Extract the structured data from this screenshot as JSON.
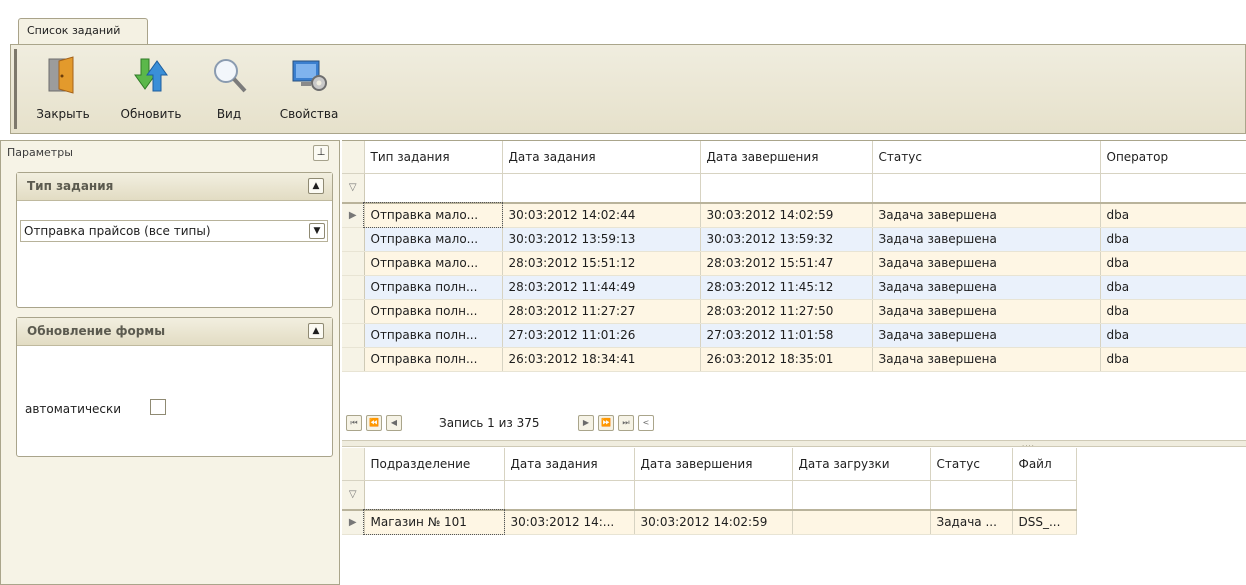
{
  "tab": {
    "title": "Список заданий"
  },
  "toolbar": {
    "buttons": [
      {
        "label": "Закрыть",
        "icon": "door-exit-icon"
      },
      {
        "label": "Обновить",
        "icon": "refresh-arrows-icon"
      },
      {
        "label": "Вид",
        "icon": "magnifier-icon"
      },
      {
        "label": "Свойства",
        "icon": "monitor-settings-icon"
      }
    ]
  },
  "left_panel": {
    "header": "Параметры",
    "task_type_group": {
      "title": "Тип задания",
      "selected": "Отправка прайсов (все типы)"
    },
    "refresh_group": {
      "title": "Обновление формы",
      "auto_label": "автоматически",
      "auto_checked": false
    }
  },
  "main_grid": {
    "columns": [
      "Тип задания",
      "Дата задания",
      "Дата завершения",
      "Статус",
      "Оператор"
    ],
    "rows": [
      [
        "Отправка мало...",
        "30:03:2012 14:02:44",
        "30:03:2012 14:02:59",
        "Задача завершена",
        "dba"
      ],
      [
        "Отправка мало...",
        "30:03:2012 13:59:13",
        "30:03:2012 13:59:32",
        "Задача завершена",
        "dba"
      ],
      [
        "Отправка мало...",
        "28:03:2012 15:51:12",
        "28:03:2012 15:51:47",
        "Задача завершена",
        "dba"
      ],
      [
        "Отправка полн...",
        "28:03:2012 11:44:49",
        "28:03:2012 11:45:12",
        "Задача завершена",
        "dba"
      ],
      [
        "Отправка полн...",
        "28:03:2012 11:27:27",
        "28:03:2012 11:27:50",
        "Задача завершена",
        "dba"
      ],
      [
        "Отправка полн...",
        "27:03:2012 11:01:26",
        "27:03:2012 11:01:58",
        "Задача завершена",
        "dba"
      ],
      [
        "Отправка полн...",
        "26:03:2012 18:34:41",
        "26:03:2012 18:35:01",
        "Задача завершена",
        "dba"
      ]
    ],
    "navigator": {
      "text": "Запись 1 из 375"
    }
  },
  "detail_grid": {
    "columns": [
      "Подразделение",
      "Дата задания",
      "Дата завершения",
      "Дата загрузки",
      "Статус",
      "Файл"
    ],
    "rows": [
      [
        "Магазин № 101",
        "30:03:2012 14:...",
        "30:03:2012 14:02:59",
        "",
        "Задача ...",
        "DSS_..."
      ]
    ]
  },
  "colors": {
    "panel_bg": "#f6f3e6",
    "row_even": "#fef6e4",
    "row_odd": "#eaf1fb",
    "border": "#aaa58b"
  }
}
